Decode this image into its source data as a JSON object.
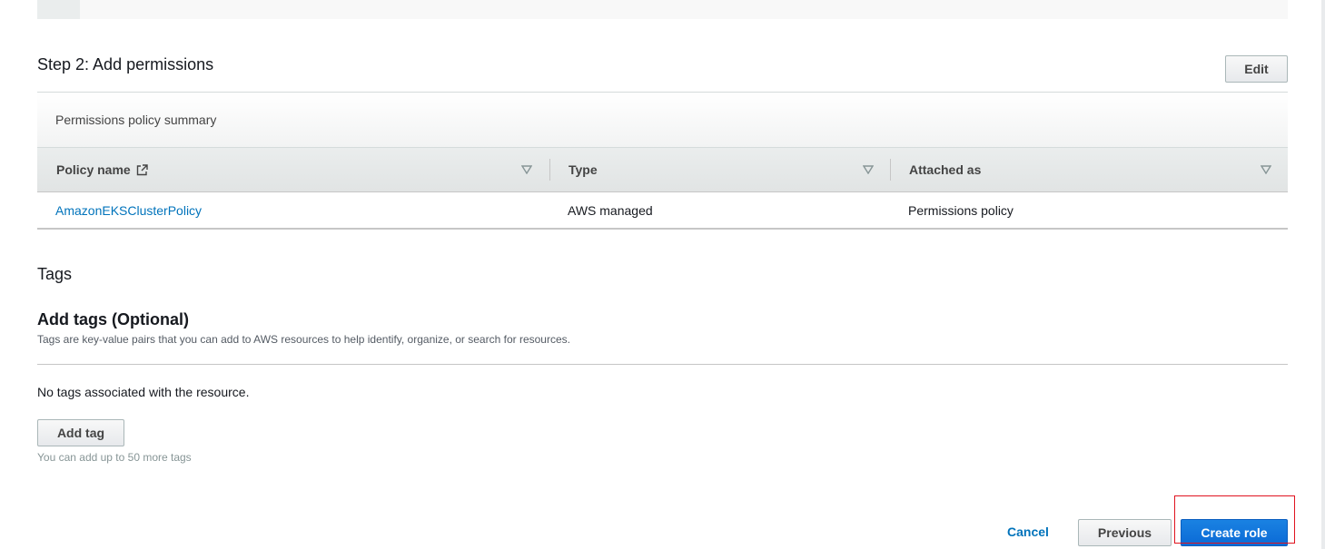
{
  "step2": {
    "title": "Step 2: Add permissions",
    "edit_label": "Edit",
    "summary_label": "Permissions policy summary",
    "columns": [
      "Policy name",
      "Type",
      "Attached as"
    ],
    "rows": [
      {
        "policy_name": "AmazonEKSClusterPolicy",
        "type": "AWS managed",
        "attached_as": "Permissions policy"
      }
    ]
  },
  "tags": {
    "section_title": "Tags",
    "add_title": "Add tags (Optional)",
    "description": "Tags are key-value pairs that you can add to AWS resources to help identify, organize, or search for resources.",
    "empty_text": "No tags associated with the resource.",
    "add_tag_label": "Add tag",
    "remaining_text": "You can add up to 50 more tags"
  },
  "footer": {
    "cancel_label": "Cancel",
    "previous_label": "Previous",
    "create_label": "Create role"
  },
  "icons": {
    "external_link": "external-link-icon",
    "sort": "sort-caret-down-icon"
  },
  "colors": {
    "link": "#0073bb",
    "primary": "#0b6ad6",
    "highlight": "#e0131f"
  }
}
